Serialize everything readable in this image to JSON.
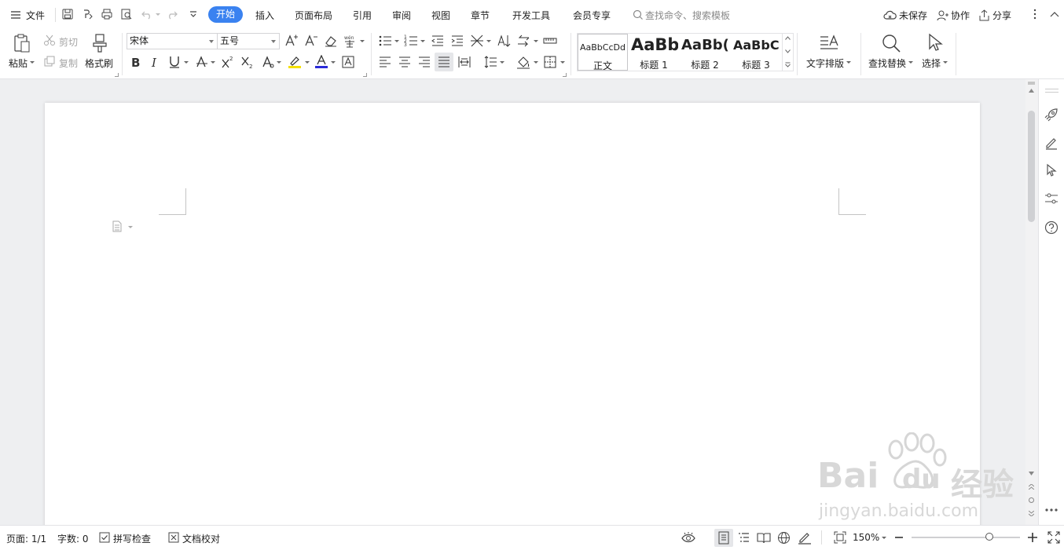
{
  "menubar": {
    "file": "文件",
    "tabs": [
      "开始",
      "插入",
      "页面布局",
      "引用",
      "审阅",
      "视图",
      "章节",
      "开发工具",
      "会员专享"
    ],
    "search_placeholder": "查找命令、搜索模板",
    "unsaved": "未保存",
    "collaborate": "协作",
    "share": "分享"
  },
  "ribbon": {
    "paste": "粘贴",
    "cut": "剪切",
    "copy": "复制",
    "format_painter": "格式刷",
    "font_name": "宋体",
    "font_size": "五号",
    "styles": [
      {
        "preview": "AaBbCcDd",
        "name": "正文"
      },
      {
        "preview": "AaBb",
        "name": "标题 1"
      },
      {
        "preview": "AaBb(",
        "name": "标题 2"
      },
      {
        "preview": "AaBbC(",
        "name": "标题 3"
      }
    ],
    "text_layout": "文字排版",
    "find_replace": "查找替换",
    "select": "选择"
  },
  "status": {
    "page": "页面: 1/1",
    "words": "字数: 0",
    "spell_check": "拼写检查",
    "doc_proof": "文档校对",
    "zoom": "150%",
    "zoom_level": 0.72
  },
  "watermark": {
    "brand": "Bai",
    "brand2": "du",
    "cn": "经验",
    "url": "jingyan.baidu.com"
  },
  "colors": {
    "accent": "#3a82f0",
    "highlight": "#f5e000",
    "font_color": "#2a2ad8"
  }
}
